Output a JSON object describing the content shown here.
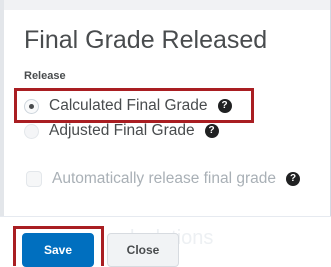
{
  "dialog": {
    "title": "Final Grade Released",
    "section_label": "Release"
  },
  "options": [
    {
      "label": "Calculated Final Grade",
      "selected": true,
      "help_icon": "help-circle-icon"
    },
    {
      "label": "Adjusted Final Grade",
      "selected": false,
      "help_icon": "help-circle-icon"
    }
  ],
  "auto_release": {
    "label": "Automatically release final grade",
    "checked": false,
    "disabled": true,
    "help_icon": "help-circle-icon"
  },
  "help_glyph": "?",
  "background_text": "lculations",
  "buttons": {
    "save_label": "Save",
    "close_label": "Close"
  },
  "colors": {
    "primary": "#006fbf",
    "highlight": "#a91e22",
    "text": "#494c4e"
  }
}
